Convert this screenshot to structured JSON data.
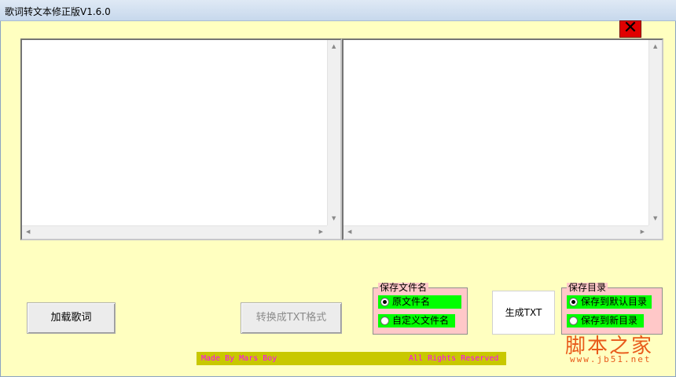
{
  "window": {
    "title": "歌词转文本修正版V1.6.0"
  },
  "buttons": {
    "load": "加载歌词",
    "convert": "转换成TXT格式",
    "generate": "生成TXT"
  },
  "filename_group": {
    "legend": "保存文件名",
    "options": [
      "原文件名",
      "自定义文件名"
    ],
    "selected": "原文件名"
  },
  "directory_group": {
    "legend": "保存目录",
    "options": [
      "保存到默认目录",
      "保存到新目录"
    ],
    "selected": "保存到默认目录"
  },
  "footer": {
    "credit": "Made By Mars Boy",
    "rights": "All Rights Reserved"
  },
  "watermark": {
    "logo": "脚本之家",
    "url": "www.jb51.net"
  },
  "colors": {
    "background": "#ffffc0",
    "option_highlight": "#00ff00",
    "group_background": "#ffc8c8",
    "footer_background": "#c8c800",
    "footer_text": "#ff00ff",
    "close_button": "#e00000"
  },
  "icons": {
    "close": "close-x-icon"
  }
}
